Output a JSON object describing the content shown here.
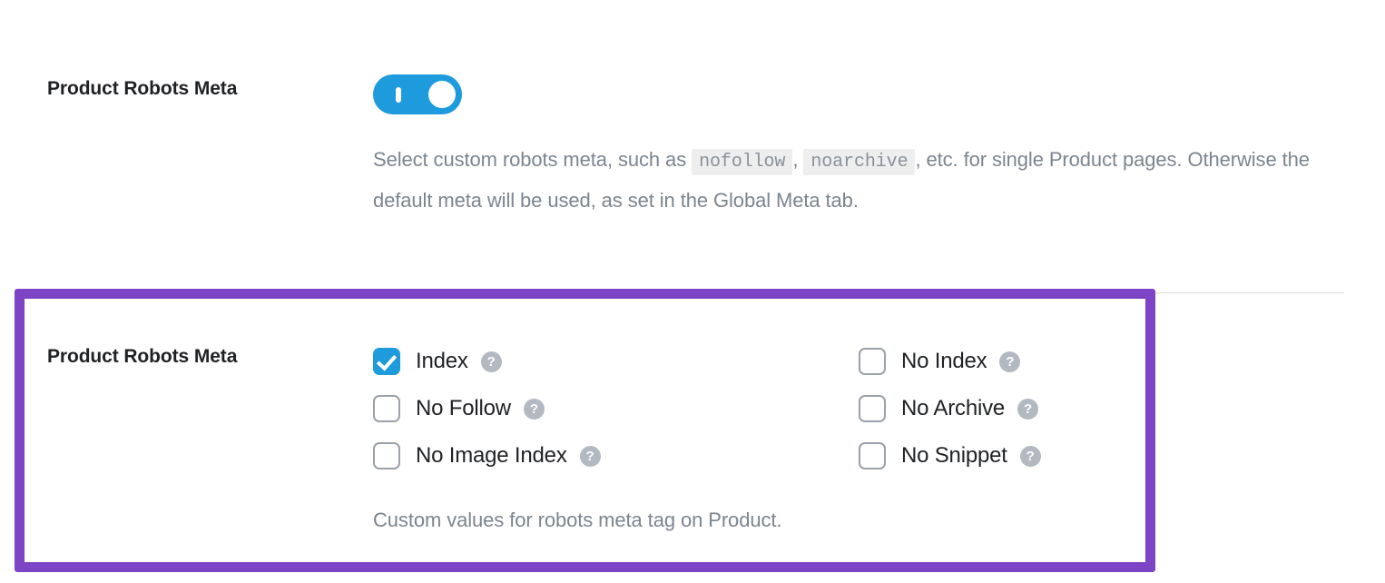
{
  "colors": {
    "accent_blue": "#1e9bdc",
    "highlight_purple": "#7e44c6",
    "muted_text": "#7c858f",
    "label_text": "#1f2124",
    "help_icon_gray": "#b2b9c0",
    "code_bg": "#eeeeee",
    "divider": "#dcdcdc"
  },
  "toggle_section": {
    "label": "Product Robots Meta",
    "toggle": {
      "state": "on",
      "aria_label": "Product Robots Meta toggle"
    },
    "description": {
      "part1": "Select custom robots meta, such as",
      "code1": "nofollow",
      "separator1": ",",
      "code2": "noarchive",
      "part2": ", etc. for single Product pages. Otherwise the default meta will be used, as set in the Global Meta tab."
    }
  },
  "robots_meta_section": {
    "label": "Product Robots Meta",
    "caption": "Custom values for robots meta tag on Product.",
    "help_icon_glyph": "?",
    "left_column": [
      {
        "label": "Index",
        "checked": true,
        "name": "checkbox-index"
      },
      {
        "label": "No Follow",
        "checked": false,
        "name": "checkbox-no-follow"
      },
      {
        "label": "No Image Index",
        "checked": false,
        "name": "checkbox-no-image-index"
      }
    ],
    "right_column": [
      {
        "label": "No Index",
        "checked": false,
        "name": "checkbox-no-index"
      },
      {
        "label": "No Archive",
        "checked": false,
        "name": "checkbox-no-archive"
      },
      {
        "label": "No Snippet",
        "checked": false,
        "name": "checkbox-no-snippet"
      }
    ]
  }
}
